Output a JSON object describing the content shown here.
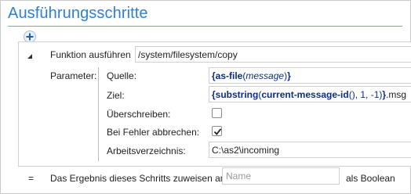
{
  "header": {
    "title": "Ausführungsschritte",
    "add_icon": "plus-circle-icon"
  },
  "step": {
    "toggle_icon": "collapse-triangle-icon",
    "function_label": "Funktion ausführen",
    "function_value": "/system/filesystem/copy",
    "params_label": "Parameter:",
    "params": {
      "source": {
        "label": "Quelle:",
        "expr": {
          "open": "{",
          "fn": "as-file",
          "lp": "(",
          "arg": "message",
          "rp": ")",
          "close": "}"
        }
      },
      "target": {
        "label": "Ziel:",
        "expr": {
          "open": "{",
          "fn": "substring",
          "lp": "(",
          "inner_fn": "current-message-id",
          "inner_parens": "()",
          "args": ", 1, -1",
          "rp": ")",
          "close": "}",
          "suffix": ".msg"
        }
      },
      "overwrite": {
        "label": "Überschreiben:",
        "checked": false
      },
      "abort_on_error": {
        "label": "Bei Fehler abbrechen:",
        "checked": true
      },
      "working_dir": {
        "label": "Arbeitsverzeichnis:",
        "value": "C:\\as2\\incoming"
      }
    }
  },
  "result": {
    "eq_symbol": "=",
    "assign_label": "Das Ergebnis dieses Schritts zuweisen an",
    "name_placeholder": "Name",
    "type_label": "als Boolean"
  },
  "colors": {
    "title": "#2f7fd0",
    "expr": "#0b2c8c",
    "border": "#cfcfcf"
  }
}
